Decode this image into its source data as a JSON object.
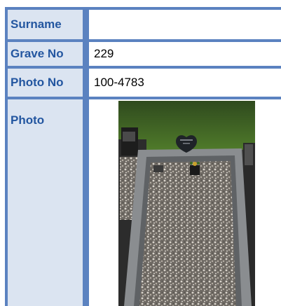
{
  "record": {
    "fields": [
      {
        "label": "Surname",
        "value": ""
      },
      {
        "label": "Grave No",
        "value": "229"
      },
      {
        "label": "Photo No",
        "value": "100-4783"
      },
      {
        "label": "Photo",
        "value": ""
      }
    ]
  },
  "colors": {
    "label_background": "#dbe4f1",
    "label_text": "#2356a0",
    "grid_lines": "#5b82c0"
  },
  "photo": {
    "icon": "grave-photo"
  }
}
